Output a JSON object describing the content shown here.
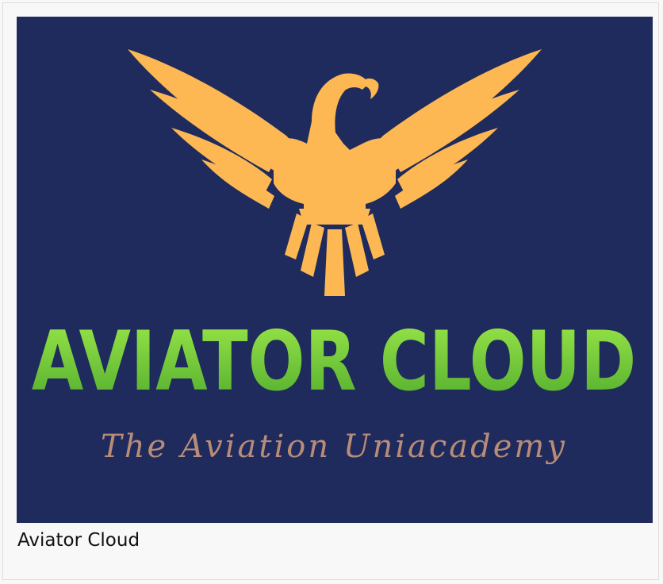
{
  "logo": {
    "name": "AVIATOR CLOUD",
    "tagline": "The Aviation Uniacademy",
    "background_color": "#1f2b5c",
    "eagle_color": "#fdb853",
    "name_gradient": [
      "#9ce84a",
      "#4faa2c"
    ],
    "tagline_color": "#b98c78",
    "icon": "eagle-icon"
  },
  "caption": {
    "text": "Aviator Cloud"
  }
}
